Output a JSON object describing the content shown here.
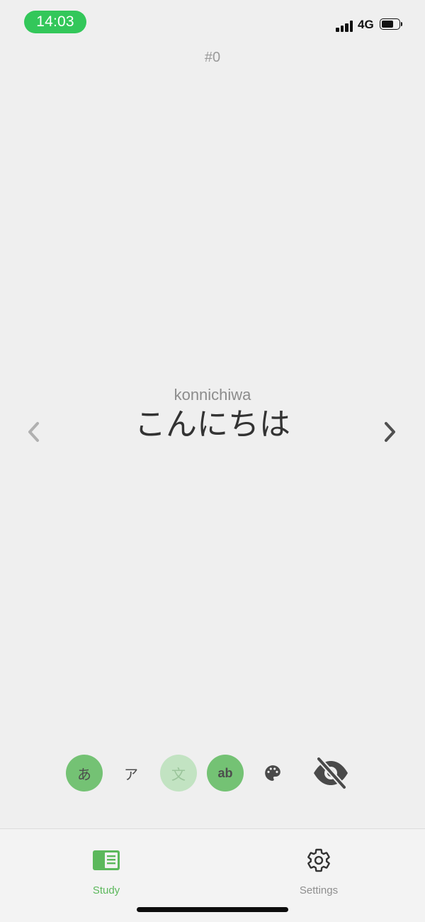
{
  "status_bar": {
    "time": "14:03",
    "network": "4G",
    "time_pill_color": "#33c75a"
  },
  "card": {
    "index": "#0",
    "romaji": "konnichiwa",
    "kana": "こんにちは"
  },
  "nav": {
    "prev_icon": "chevron-left-icon",
    "next_icon": "chevron-right-icon"
  },
  "toolbar": {
    "hiragana_label": "あ",
    "katakana_label": "ア",
    "kanji_label": "文",
    "romaji_label": "ab",
    "theme_icon": "palette-icon",
    "hide_icon": "eye-off-icon",
    "active_color": "#74c274"
  },
  "tabs": {
    "study_label": "Study",
    "settings_label": "Settings",
    "active_color": "#5cb85c"
  }
}
